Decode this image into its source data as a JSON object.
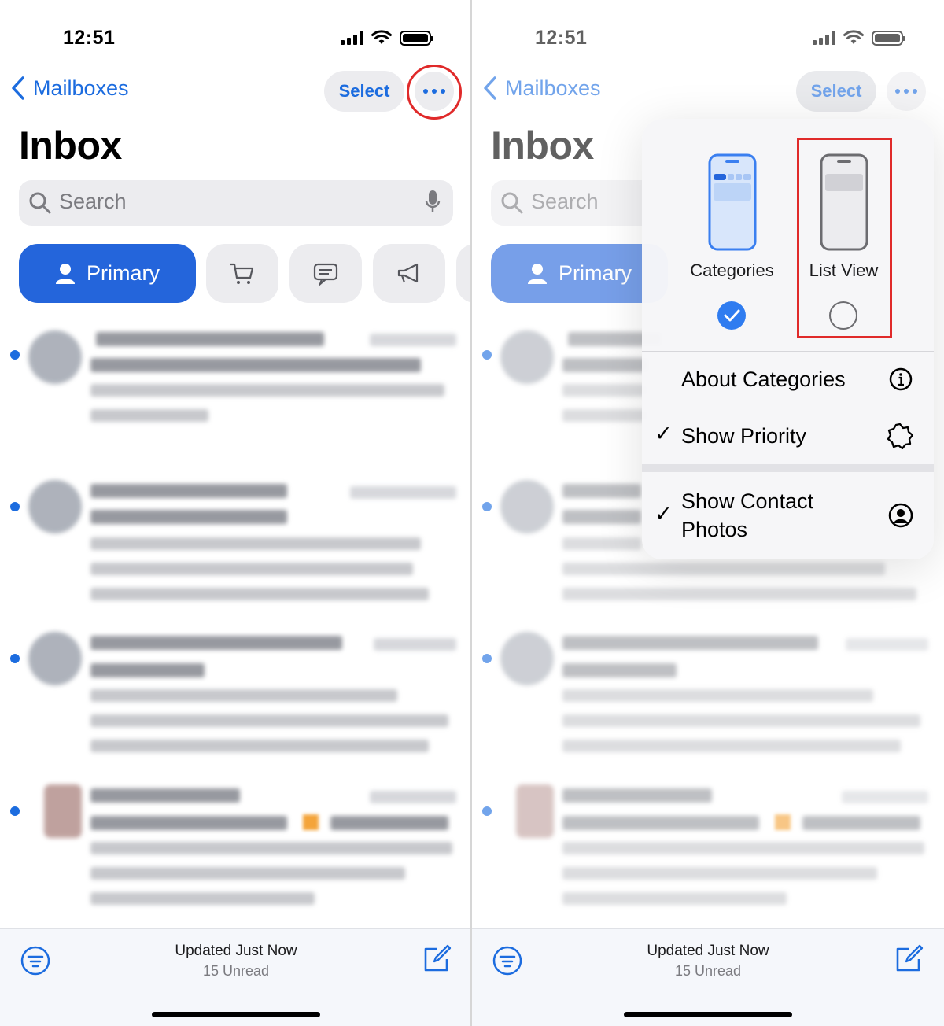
{
  "status": {
    "time": "12:51"
  },
  "nav": {
    "back_label": "Mailboxes",
    "select_label": "Select"
  },
  "inbox": {
    "title": "Inbox"
  },
  "search": {
    "placeholder": "Search"
  },
  "categories": {
    "primary_label": "Primary"
  },
  "toolbar": {
    "updated": "Updated Just Now",
    "unread": "15 Unread"
  },
  "menu": {
    "view_options": [
      {
        "label": "Categories",
        "selected": true
      },
      {
        "label": "List View",
        "selected": false
      }
    ],
    "about_label": "About Categories",
    "priority_label": "Show Priority",
    "priority_checked": true,
    "photos_label_line1": "Show Contact",
    "photos_label_line2": "Photos",
    "photos_checked": true
  },
  "colors": {
    "accent": "#1c6cdf",
    "primary_chip": "#2465db",
    "highlight": "#e02a2a"
  }
}
